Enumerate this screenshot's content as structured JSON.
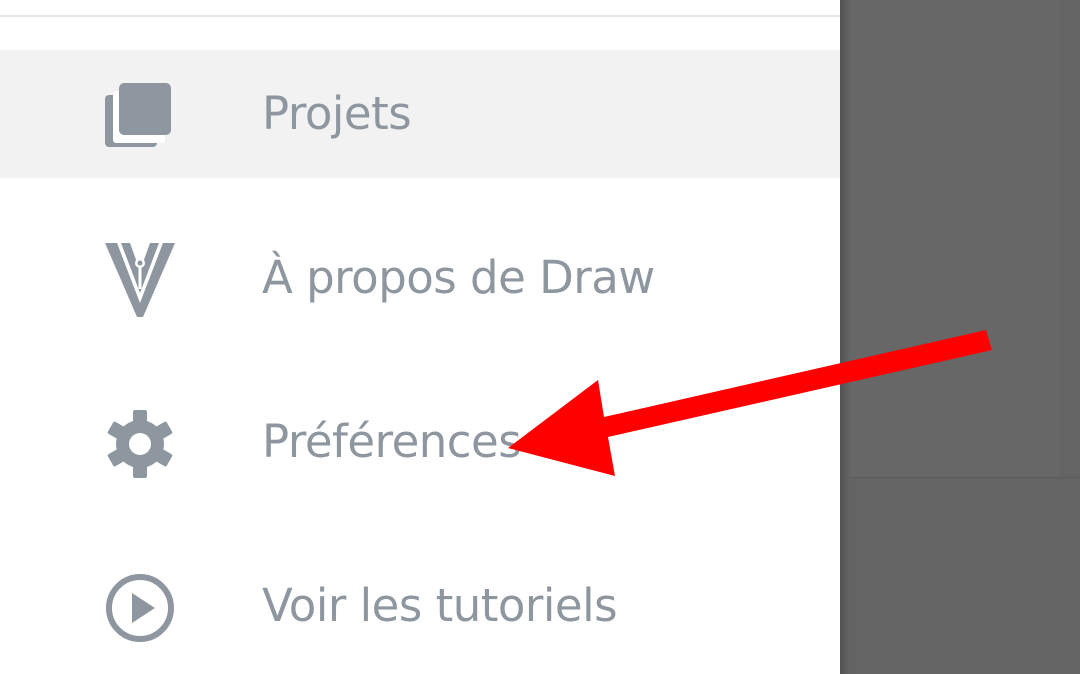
{
  "menu": {
    "items": [
      {
        "label": "Projets",
        "icon": "projects-icon",
        "selected": true
      },
      {
        "label": "À propos de Draw",
        "icon": "draw-pen-nib-icon",
        "selected": false
      },
      {
        "label": "Préférences",
        "icon": "gear-icon",
        "selected": false
      },
      {
        "label": "Voir les tutoriels",
        "icon": "play-circle-icon",
        "selected": false
      }
    ]
  },
  "colors": {
    "icon": "#8e979f",
    "label": "#8e979f",
    "selected_background": "#f2f2f2",
    "scrim": "#646464",
    "annotation_arrow": "#ff0000"
  }
}
